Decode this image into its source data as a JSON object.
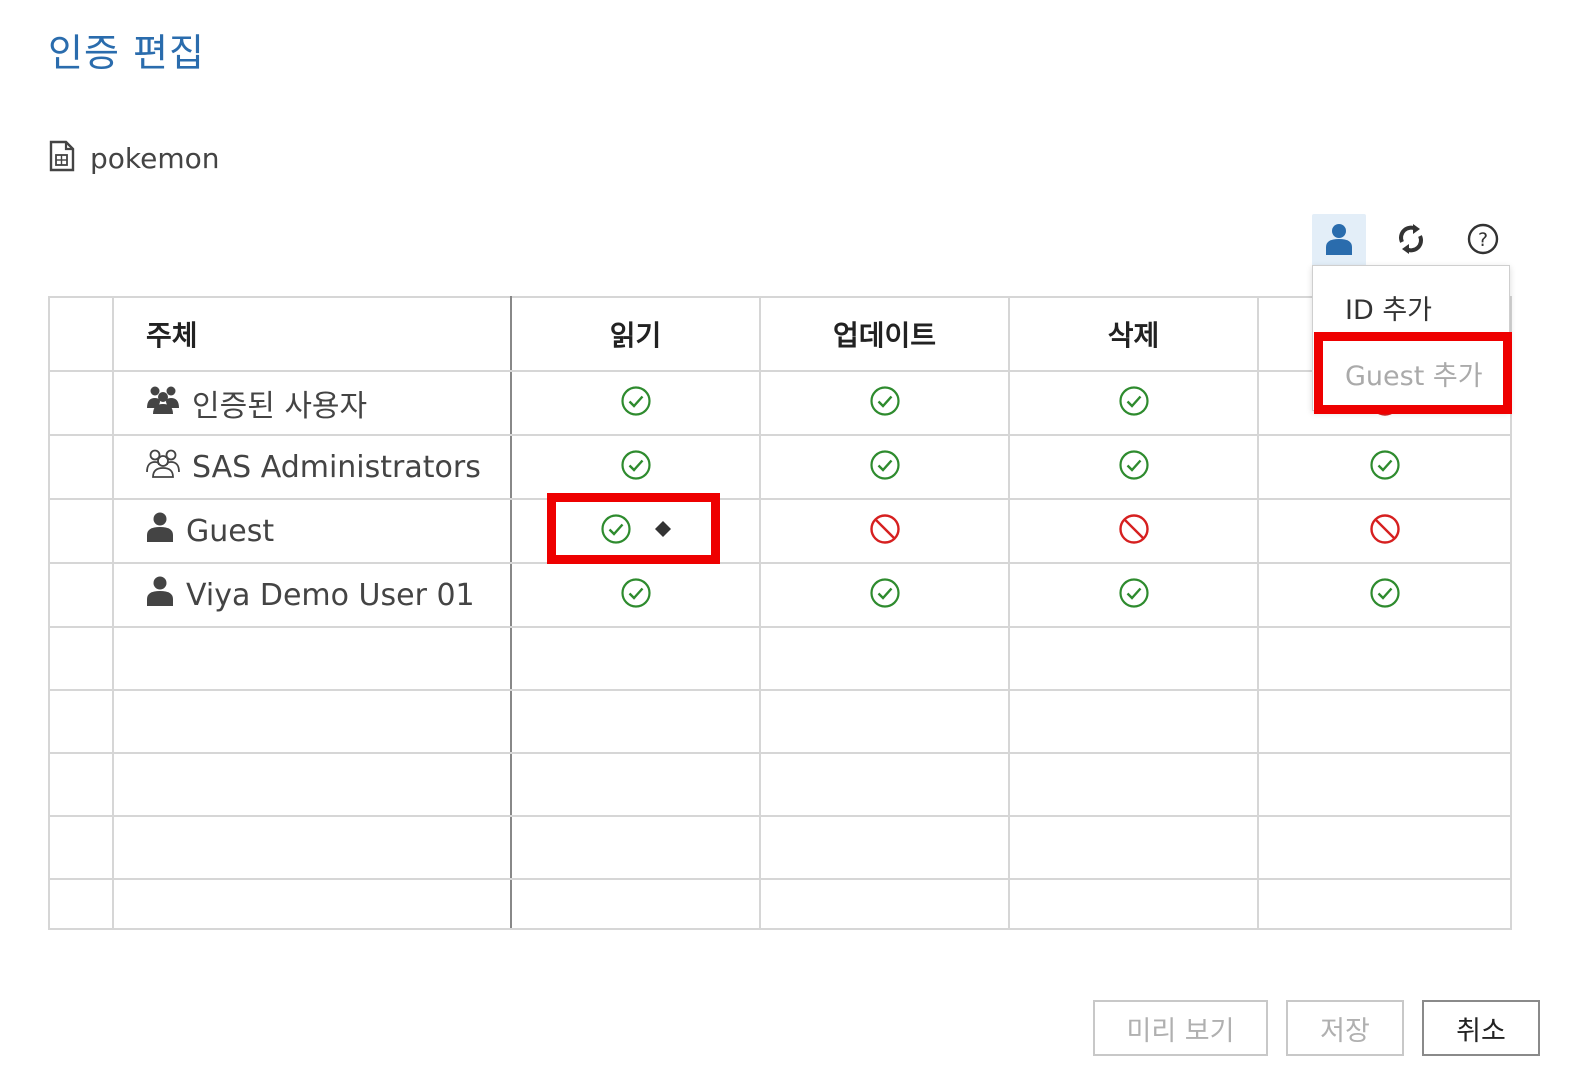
{
  "dialog": {
    "title": "인증 편집"
  },
  "object": {
    "name": "pokemon",
    "icon": "document-icon"
  },
  "toolbar": {
    "buttons": [
      {
        "name": "add-identity-icon",
        "active": true
      },
      {
        "name": "refresh-icon",
        "active": false
      },
      {
        "name": "help-icon",
        "active": false
      }
    ]
  },
  "dropdown": {
    "items": [
      {
        "label": "ID 추가",
        "enabled": true
      },
      {
        "label": "Guest 추가",
        "enabled": false
      }
    ]
  },
  "table": {
    "headers": {
      "subject": "주체",
      "read": "읽기",
      "update": "업데이트",
      "delete": "삭제"
    },
    "rows": [
      {
        "subject": "인증된 사용자",
        "icon": "authenticated-users-icon",
        "read": "grant",
        "update": "grant",
        "delete": "grant",
        "fourth": "deny"
      },
      {
        "subject": "SAS Administrators",
        "icon": "group-icon",
        "read": "grant",
        "update": "grant",
        "delete": "grant",
        "fourth": "grant"
      },
      {
        "subject": "Guest",
        "icon": "user-icon",
        "read": "grant",
        "read_marker": "diamond",
        "update": "deny",
        "delete": "deny",
        "fourth": "deny"
      },
      {
        "subject": "Viya Demo User 01",
        "icon": "user-icon",
        "read": "grant",
        "update": "grant",
        "delete": "grant",
        "fourth": "grant"
      }
    ]
  },
  "footer": {
    "preview": "미리 보기",
    "save": "저장",
    "cancel": "취소"
  },
  "colors": {
    "title": "#2a6cad",
    "grant": "#2e8b2e",
    "deny": "#d62020",
    "highlight": "#ee0000"
  }
}
